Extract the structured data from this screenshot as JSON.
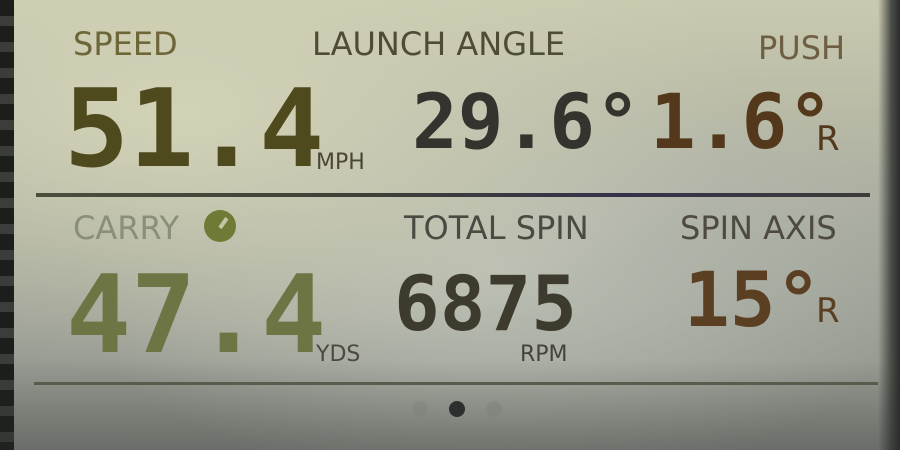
{
  "metrics": {
    "speed": {
      "label": "SPEED",
      "value": "51.4",
      "unit": "MPH"
    },
    "launch_angle": {
      "label": "LAUNCH ANGLE",
      "value": "29.6°"
    },
    "push": {
      "label": "PUSH",
      "value": "1.6°",
      "direction": "R"
    },
    "carry": {
      "label": "CARRY",
      "value": "47.4",
      "unit": "YDS",
      "icon": "carry-indicator-icon"
    },
    "total_spin": {
      "label": "TOTAL SPIN",
      "value": "6875",
      "unit": "RPM"
    },
    "spin_axis": {
      "label": "SPIN AXIS",
      "value": "15°",
      "direction": "R"
    }
  },
  "pagination": {
    "page_count": 3,
    "active_page": 2
  },
  "colors": {
    "screen_background": "#c9caaf",
    "speed_value": "#4f4a1e",
    "carry_value": "#6e7545",
    "numbers_dark": "#3c3830",
    "numbers_brown": "#5a3f22",
    "labels": "#5a5a3a",
    "carry_icon": "#6f7a36"
  }
}
